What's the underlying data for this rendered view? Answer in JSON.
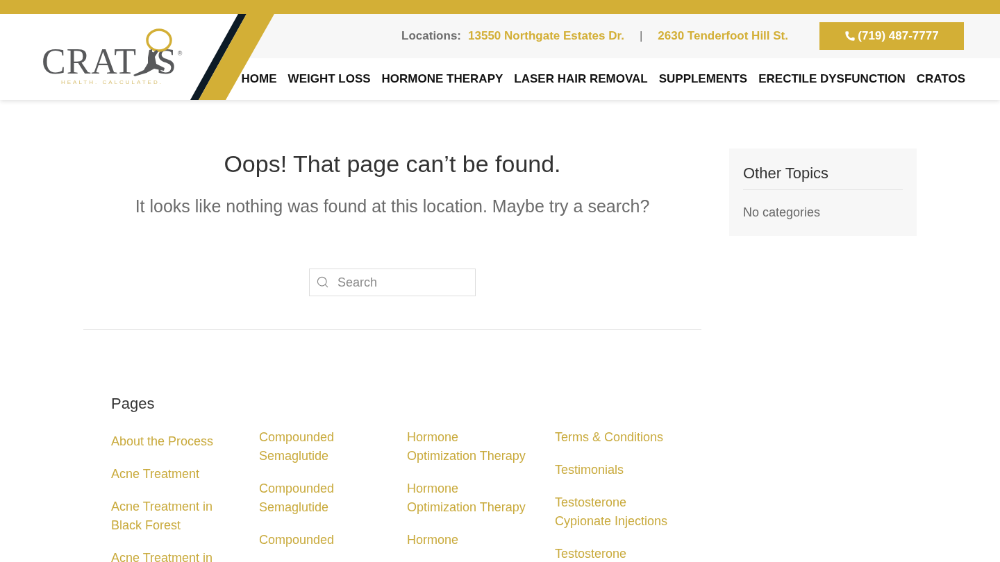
{
  "logo": {
    "name_start": "CRAT",
    "name_end": "S",
    "registered_mark": "®",
    "tagline": "HEALTH. CALCULATED."
  },
  "top_bar": {
    "locations_label": "Locations:",
    "addresses": [
      "13550 Northgate Estates Dr.",
      "2630 Tenderfoot Hill St."
    ],
    "separator": "|",
    "phone_button": "(719) 487-7777"
  },
  "nav": {
    "items": [
      "HOME",
      "WEIGHT LOSS",
      "HORMONE THERAPY",
      "LASER HAIR REMOVAL",
      "SUPPLEMENTS",
      "ERECTILE DYSFUNCTION",
      "CRATOS"
    ]
  },
  "main": {
    "title": "Oops! That page can’t be found.",
    "message": "It looks like nothing was found at this location. Maybe try a search?",
    "search": {
      "placeholder": "Search"
    },
    "pages": {
      "heading": "Pages",
      "columns": [
        [
          "About the Process",
          "Acne Treatment",
          "Acne Treatment in Black Forest",
          "Acne Treatment in"
        ],
        [
          "Compounded Semaglutide",
          "Compounded Semaglutide",
          "Compounded"
        ],
        [
          "Hormone Optimization Therapy",
          "Hormone Optimization Therapy",
          "Hormone"
        ],
        [
          "Terms & Conditions",
          "Testimonials",
          "Testosterone Cypionate Injections",
          "Testosterone"
        ]
      ]
    }
  },
  "sidebar": {
    "title": "Other Topics",
    "text": "No categories"
  }
}
